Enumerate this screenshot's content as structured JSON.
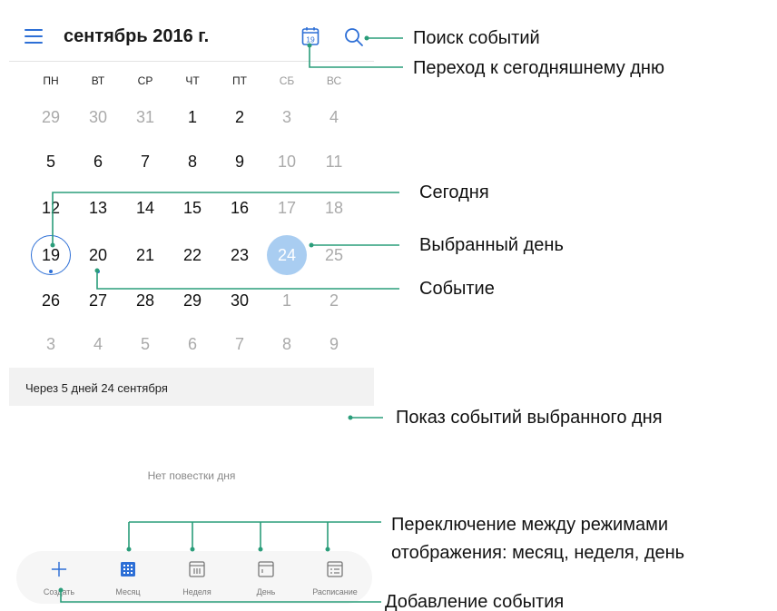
{
  "header": {
    "title": "сентябрь 2016 г.",
    "today_icon_day": "19"
  },
  "weekdays": [
    "ПН",
    "ВТ",
    "СР",
    "ЧТ",
    "ПТ",
    "СБ",
    "ВС"
  ],
  "calendar": {
    "rows": [
      [
        "29",
        "30",
        "31",
        "1",
        "2",
        "3",
        "4"
      ],
      [
        "5",
        "6",
        "7",
        "8",
        "9",
        "10",
        "11"
      ],
      [
        "12",
        "13",
        "14",
        "15",
        "16",
        "17",
        "18"
      ],
      [
        "19",
        "20",
        "21",
        "22",
        "23",
        "24",
        "25"
      ],
      [
        "26",
        "27",
        "28",
        "29",
        "30",
        "1",
        "2"
      ],
      [
        "3",
        "4",
        "5",
        "6",
        "7",
        "8",
        "9"
      ]
    ],
    "today": "19",
    "selected": "24"
  },
  "summary": {
    "label": "Через 5 дней 24 сентября"
  },
  "agenda": {
    "empty_text": "Нет повестки дня"
  },
  "bottom_nav": {
    "create": "Создать",
    "month": "Месяц",
    "week": "Неделя",
    "day": "День",
    "schedule": "Расписание"
  },
  "callouts": {
    "search": "Поиск событий",
    "go_today": "Переход к сегодняшнему дню",
    "today": "Сегодня",
    "selected_day": "Выбранный день",
    "event": "Событие",
    "day_events": "Показ событий выбранного дня",
    "switch_modes_1": "Переключение между режимами",
    "switch_modes_2": "отображения: месяц, неделя, день",
    "add_event": "Добавление события"
  },
  "colors": {
    "accent": "#2d6fd6",
    "selected_fill": "#a9cdf1",
    "callout_line": "#2a9d7a"
  }
}
